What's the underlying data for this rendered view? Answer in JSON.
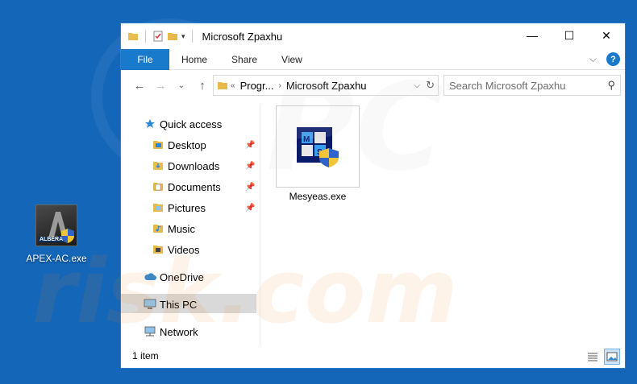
{
  "desktop": {
    "icon": {
      "label": "APEX-AC.exe",
      "tag": "ALBERA"
    }
  },
  "window": {
    "title": "Microsoft Zpaxhu",
    "controls": {
      "minimize": "—",
      "maximize": "☐",
      "close": "✕"
    },
    "ribbon": {
      "tabs": [
        "File",
        "Home",
        "Share",
        "View"
      ],
      "help": "?"
    },
    "address": {
      "crumbs": [
        "Progr...",
        "Microsoft Zpaxhu"
      ]
    },
    "search": {
      "placeholder": "Search Microsoft Zpaxhu"
    },
    "nav": {
      "quick_access": "Quick access",
      "items": [
        "Desktop",
        "Downloads",
        "Documents",
        "Pictures",
        "Music",
        "Videos"
      ],
      "onedrive": "OneDrive",
      "this_pc": "This PC",
      "network": "Network"
    },
    "files": [
      {
        "name": "Mesyeas.exe"
      }
    ],
    "status": {
      "count": "1 item"
    }
  },
  "colors": {
    "desktop": "#1466b8",
    "accent": "#1979ca"
  }
}
